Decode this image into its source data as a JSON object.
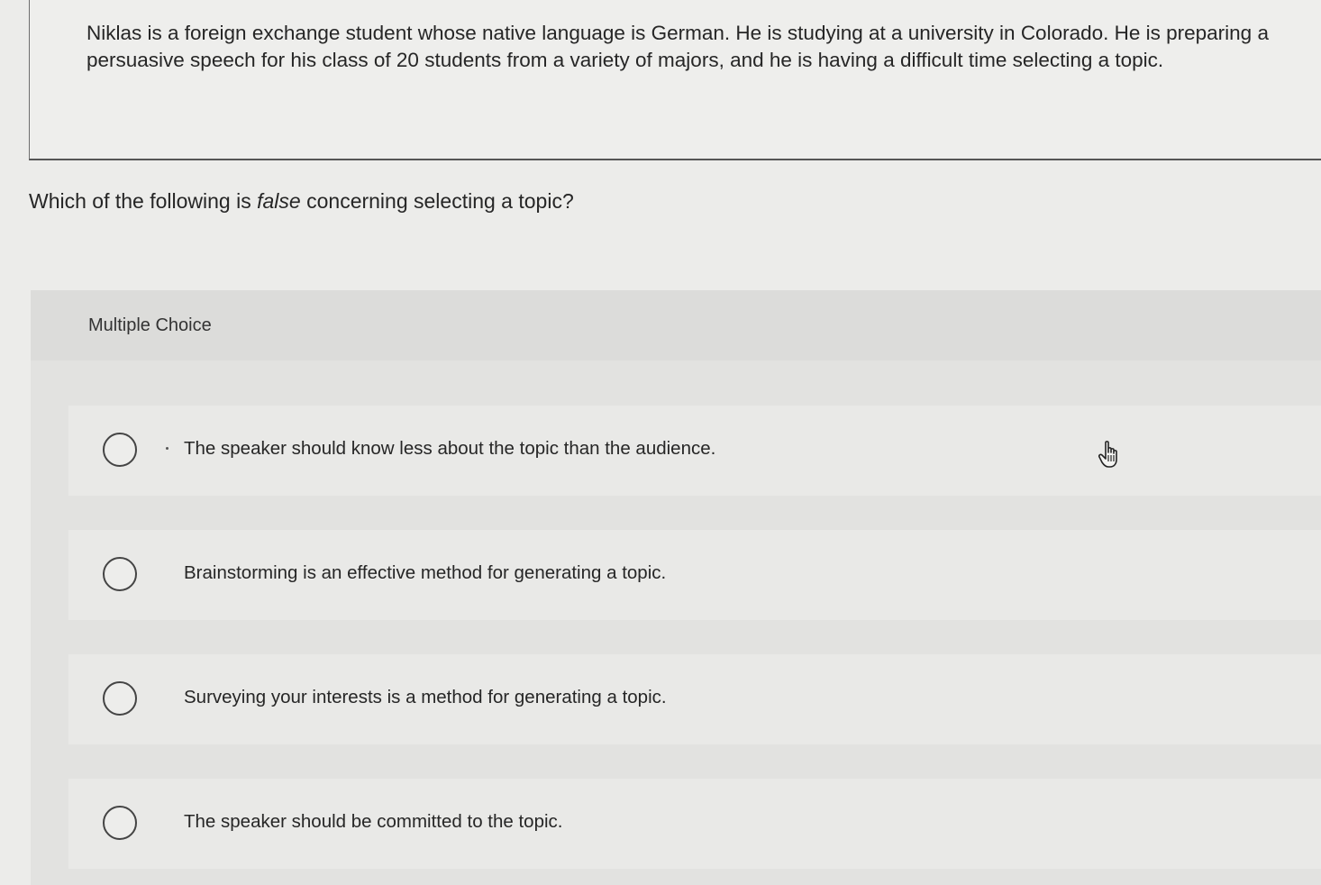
{
  "scenario": {
    "text": "Niklas is a foreign exchange student whose native language is German. He is studying at a university in Colorado. He is preparing a persuasive speech for his class of 20 students from a variety of majors, and he is having a difficult time selecting a topic."
  },
  "question": {
    "prefix": "Which of the following is ",
    "emphasis": "false",
    "suffix": " concerning selecting a topic?"
  },
  "multiple_choice": {
    "label": "Multiple Choice",
    "options": [
      {
        "label": "The speaker should know less about the topic than the audience."
      },
      {
        "label": "Brainstorming is an effective method for generating a topic."
      },
      {
        "label": "Surveying your interests is a method for generating a topic."
      },
      {
        "label": "The speaker should be committed to the topic."
      }
    ]
  },
  "icons": {
    "cursor": "hand-pointer-icon"
  }
}
